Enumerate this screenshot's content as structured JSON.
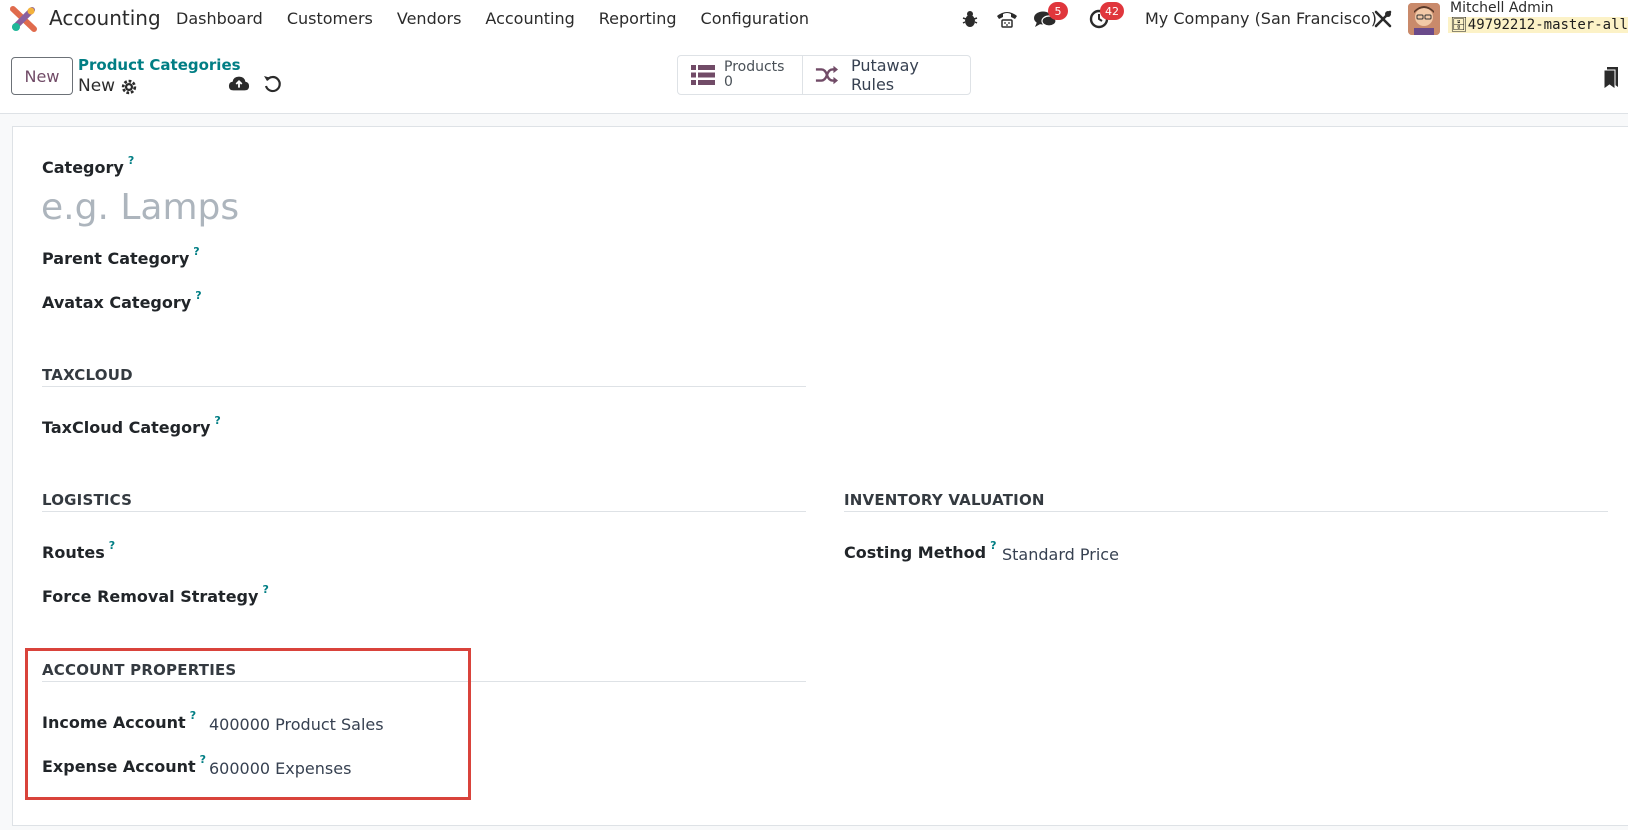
{
  "navbar": {
    "app_name": "Accounting",
    "menu": [
      "Dashboard",
      "Customers",
      "Vendors",
      "Accounting",
      "Reporting",
      "Configuration"
    ],
    "messages_badge": "5",
    "activities_badge": "42",
    "company": "My Company (San Francisco)",
    "user_name": "Mitchell Admin",
    "database": "49792212-master-all"
  },
  "control": {
    "new_label": "New",
    "breadcrumb": "Product Categories",
    "record_name": "New",
    "smart_buttons": {
      "products_label": "Products",
      "products_count": "0",
      "putaway_label": "Putaway Rules"
    }
  },
  "form": {
    "category_label": "Category",
    "category_placeholder": "e.g. Lamps",
    "parent_category_label": "Parent Category",
    "avatax_category_label": "Avatax Category",
    "taxcloud_title": "TAXCLOUD",
    "taxcloud_category_label": "TaxCloud Category",
    "logistics_title": "LOGISTICS",
    "routes_label": "Routes",
    "force_removal_label": "Force Removal Strategy",
    "inventory_title": "INVENTORY VALUATION",
    "costing_method_label": "Costing Method",
    "costing_method_value": "Standard Price",
    "account_title": "ACCOUNT PROPERTIES",
    "income_account_label": "Income Account",
    "income_account_value": "400000 Product Sales",
    "expense_account_label": "Expense Account",
    "expense_account_value": "600000 Expenses",
    "help_mark": "?"
  },
  "colors": {
    "brand": "#714b67",
    "link": "#017e84",
    "badge": "#e0363c",
    "highlight": "#d9433b"
  }
}
